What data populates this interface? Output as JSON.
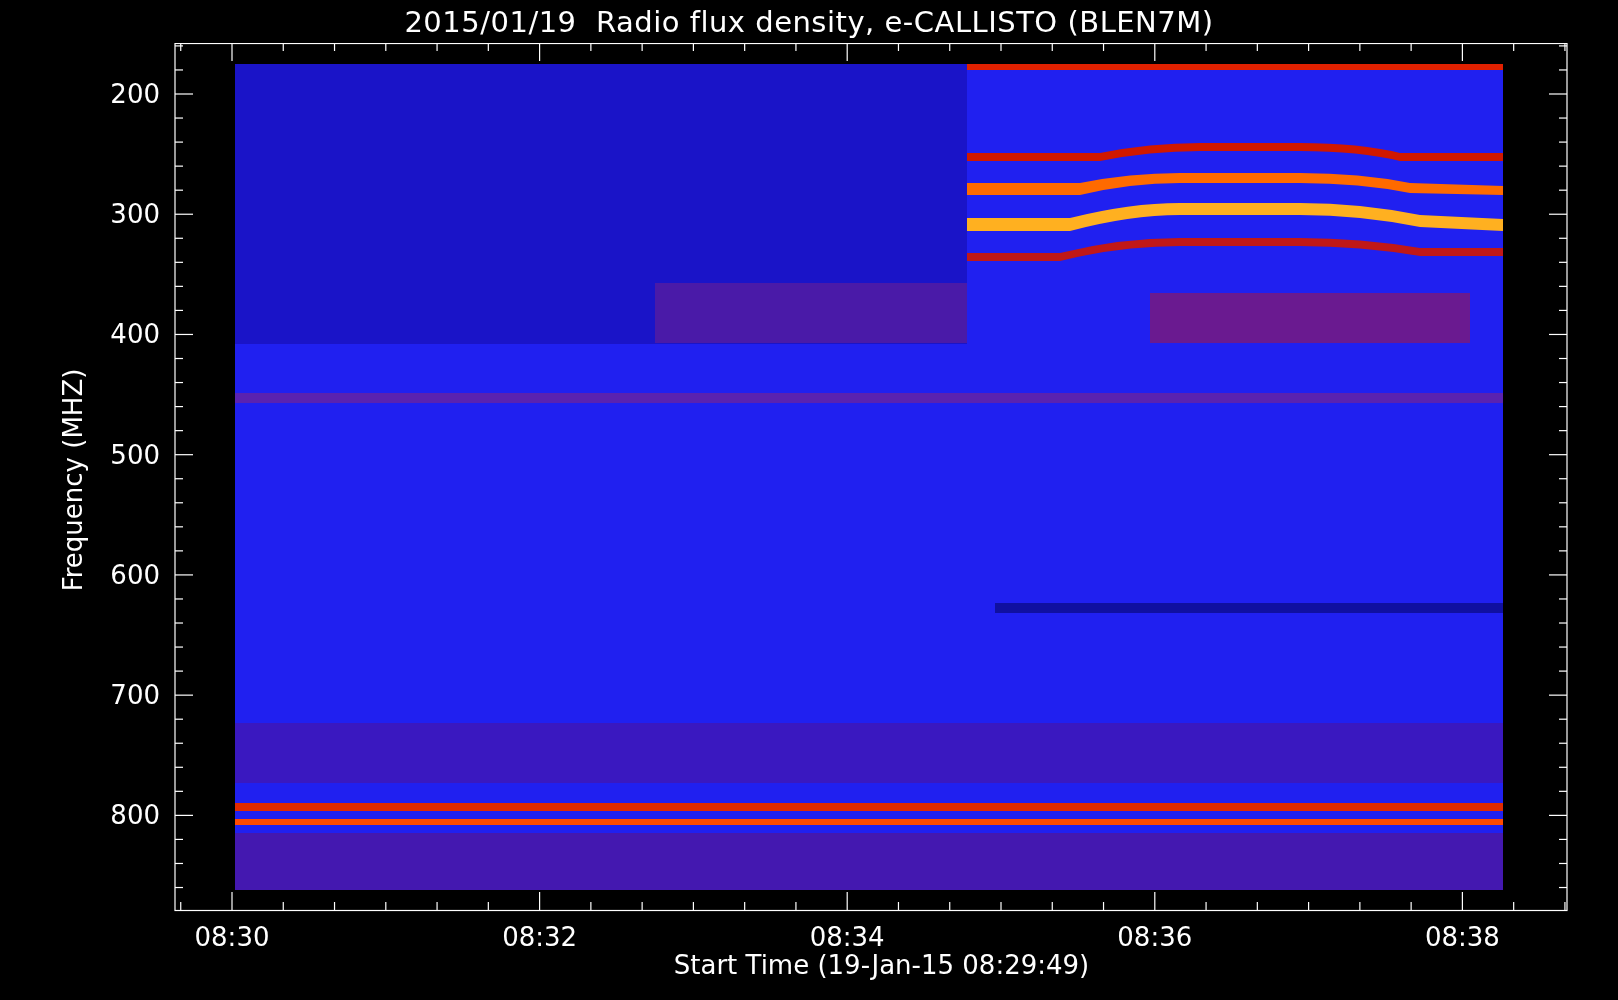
{
  "title": "2015/01/19  Radio flux density, e-CALLISTO (BLEN7M)",
  "y_axis": {
    "label": "Frequency (MHZ)",
    "ticks": [
      "200",
      "300",
      "400",
      "500",
      "600",
      "700",
      "800"
    ]
  },
  "x_axis": {
    "label": "Start Time (19-Jan-15 08:29:49)",
    "ticks": [
      "08:30",
      "08:32",
      "08:34",
      "08:36",
      "08:38"
    ]
  }
}
